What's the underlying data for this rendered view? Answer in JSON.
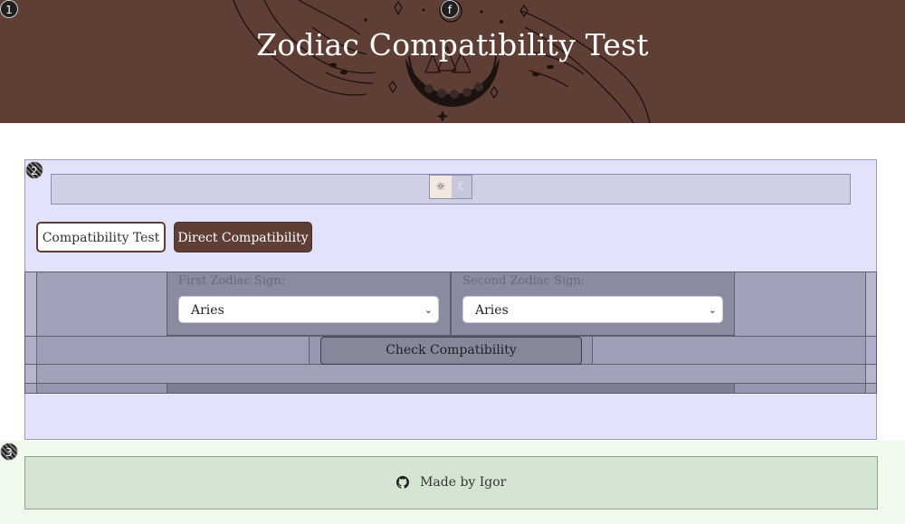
{
  "header": {
    "title": "Zodiac Compatibility Test",
    "background_color": "#5f3e35"
  },
  "badges": {
    "b1": "1",
    "b2": "2",
    "b3": "3",
    "header_icon": "f"
  },
  "theme_toggle": {
    "light_icon": "☼",
    "dark_icon": "☾"
  },
  "tabs": [
    {
      "label": "Compatibility Test",
      "active": false
    },
    {
      "label": "Direct Compatibility",
      "active": true
    }
  ],
  "form": {
    "first_label": "First Zodiac Sign:",
    "first_value": "Aries",
    "second_label": "Second Zodiac Sign:",
    "second_value": "Aries",
    "check_button": "Check Compatibility"
  },
  "footer": {
    "text": "Made by Igor",
    "icon": "github-icon"
  },
  "colors": {
    "accent": "#5f3e35",
    "main_bg": "#e2e2fb",
    "footer_bg": "#d4e5d2"
  }
}
